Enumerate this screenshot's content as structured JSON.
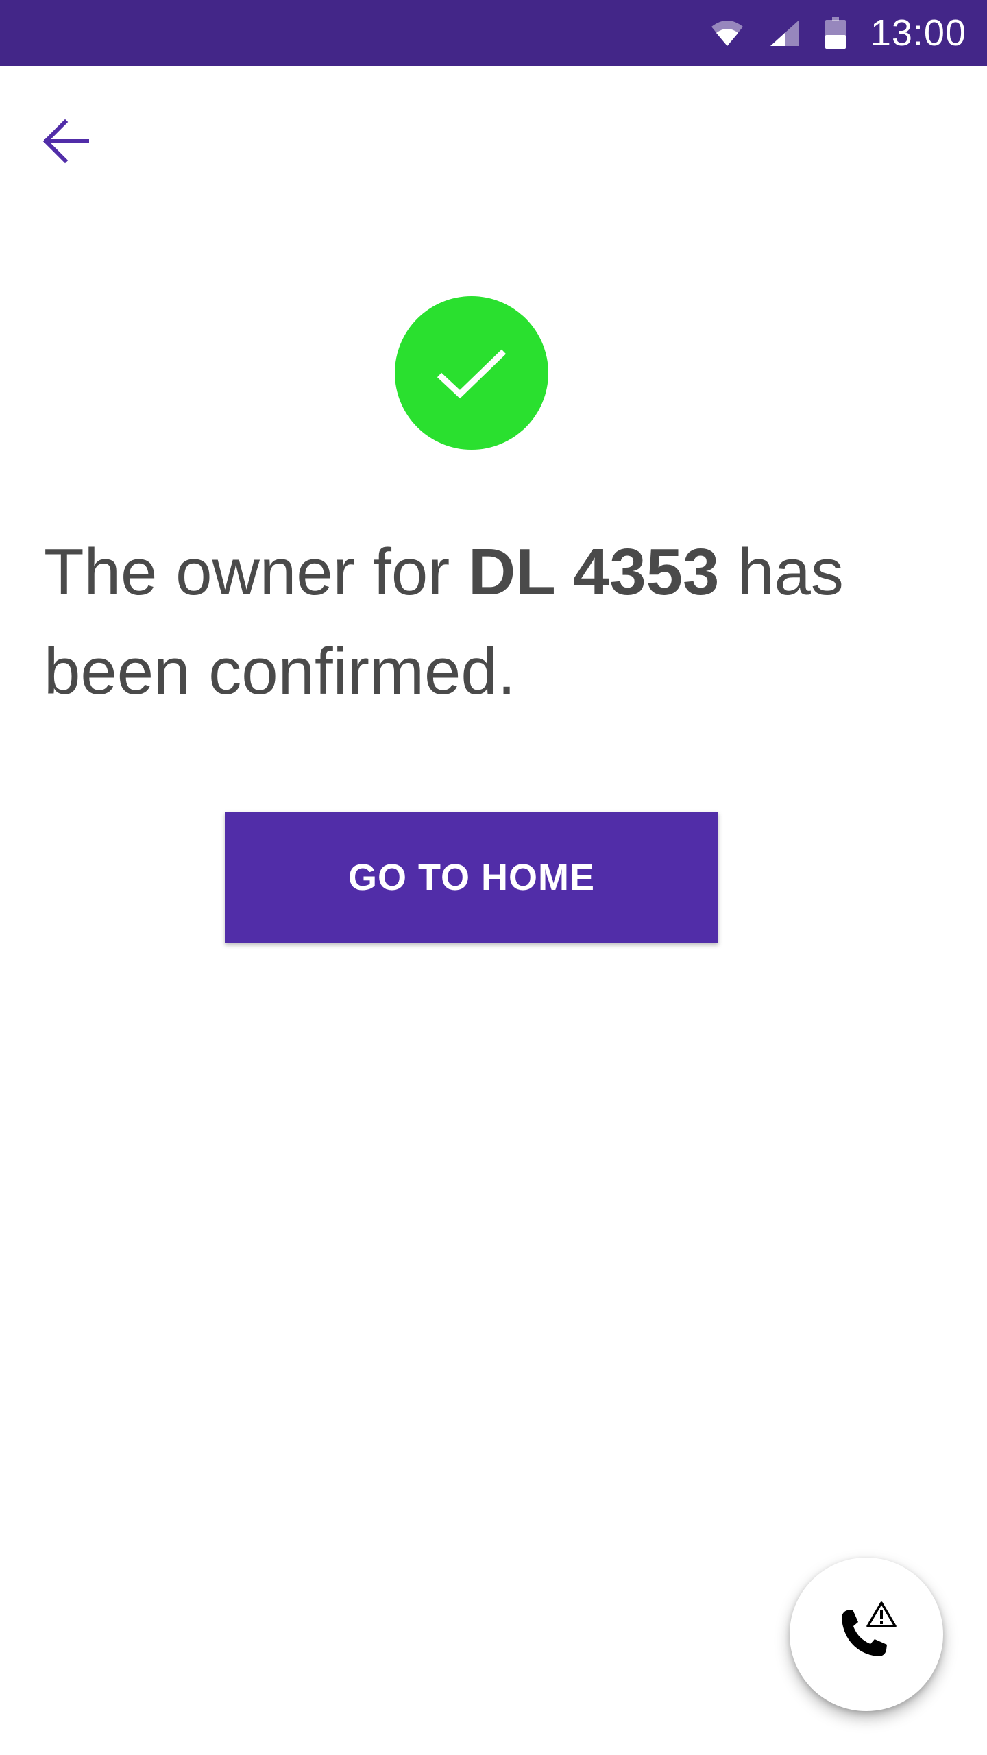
{
  "status_bar": {
    "time": "13:00",
    "background_color": "#432688",
    "icons": [
      "wifi-icon",
      "signal-icon",
      "battery-icon"
    ]
  },
  "toolbar": {
    "back_icon": "arrow-left-icon",
    "accent_color": "#512da8"
  },
  "confirmation": {
    "icon": "check-circle-icon",
    "icon_color": "#2ae02f",
    "message_prefix": "The owner for ",
    "vehicle_id": "DL 4353",
    "message_suffix": " has been confirmed."
  },
  "actions": {
    "home_button_label": "GO TO HOME",
    "button_color": "#512da8"
  },
  "fab": {
    "icon": "phone-alert-icon"
  }
}
